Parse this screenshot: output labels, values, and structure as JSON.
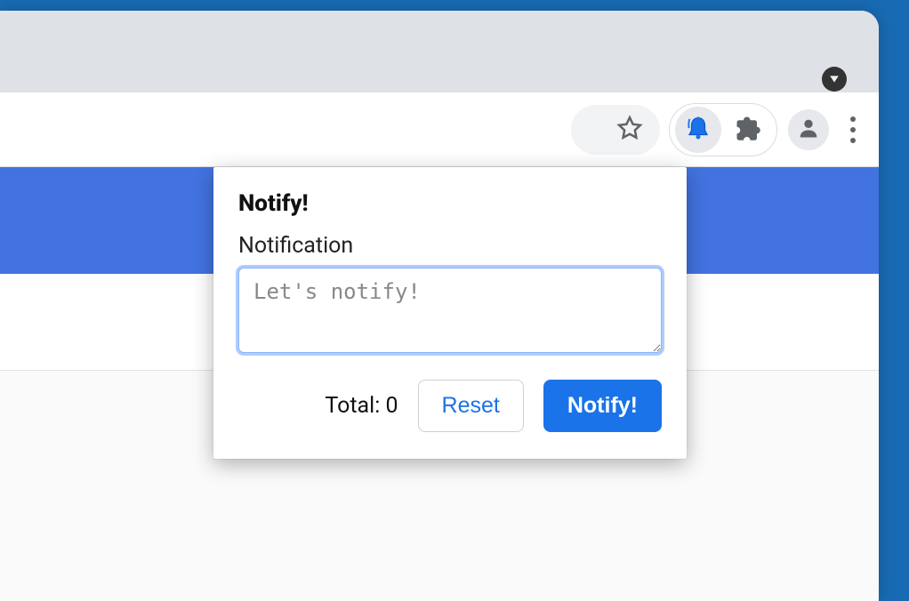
{
  "popup": {
    "title": "Notify!",
    "field_label": "Notification",
    "textarea_placeholder": "Let's notify!",
    "textarea_value": "",
    "total_label": "Total: ",
    "total_count": "0",
    "reset_label": "Reset",
    "notify_label": "Notify!"
  },
  "icons": {
    "star": "star-icon",
    "bell": "bell-icon",
    "extension": "puzzle-icon",
    "profile": "person-icon",
    "menu": "kebab-icon",
    "window_dropdown": "triangle-down-icon"
  },
  "colors": {
    "accent": "#1a73e8",
    "banner": "#4273e0",
    "desktop": "#186bb3"
  }
}
